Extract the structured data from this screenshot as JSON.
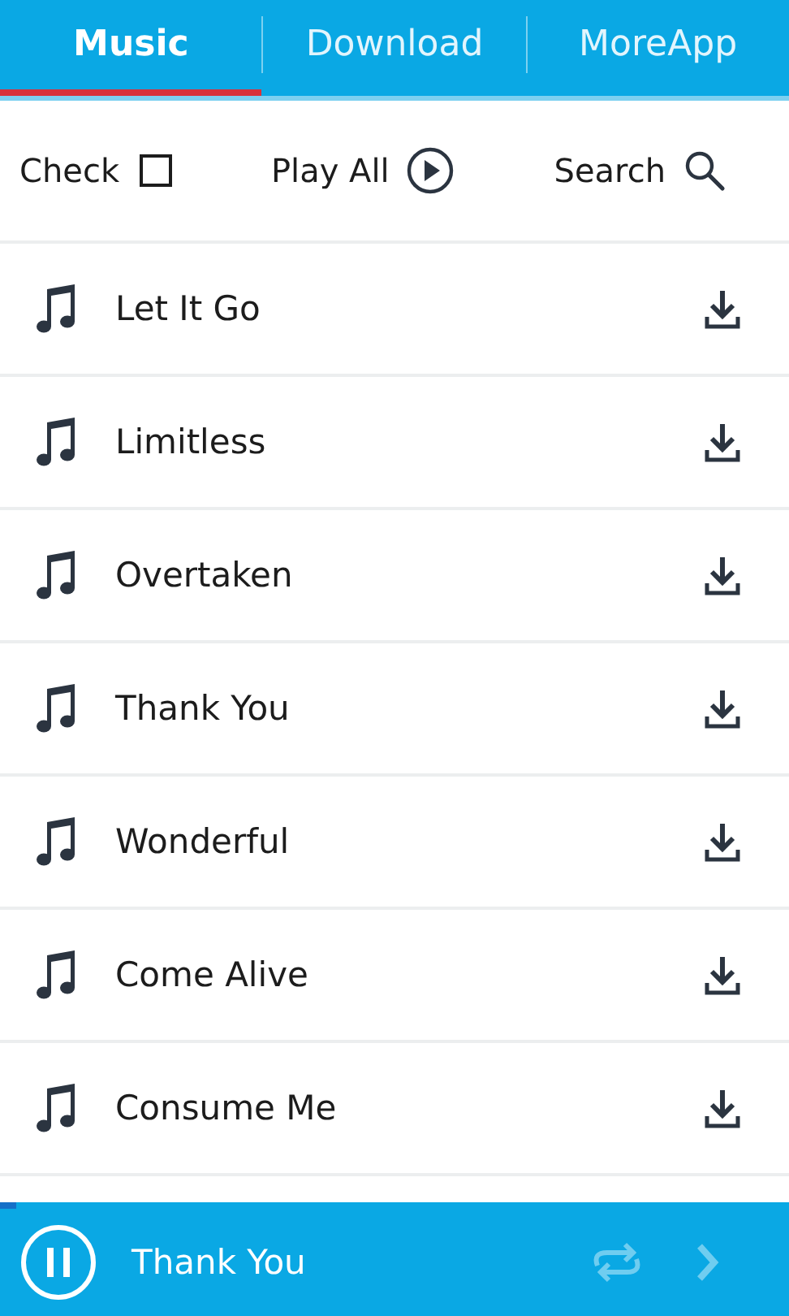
{
  "tabs": [
    {
      "label": "Music",
      "selected": true
    },
    {
      "label": "Download",
      "selected": false
    },
    {
      "label": "MoreApp",
      "selected": false
    }
  ],
  "toolbar": {
    "check": {
      "label": "Check",
      "checked": false
    },
    "play_all": {
      "label": "Play All"
    },
    "search": {
      "label": "Search"
    }
  },
  "songs": [
    {
      "title": "Let It Go"
    },
    {
      "title": "Limitless"
    },
    {
      "title": "Overtaken"
    },
    {
      "title": "Thank You"
    },
    {
      "title": "Wonderful"
    },
    {
      "title": "Come Alive"
    },
    {
      "title": "Consume Me"
    }
  ],
  "player": {
    "title": "Thank You",
    "level": 0.02
  }
}
